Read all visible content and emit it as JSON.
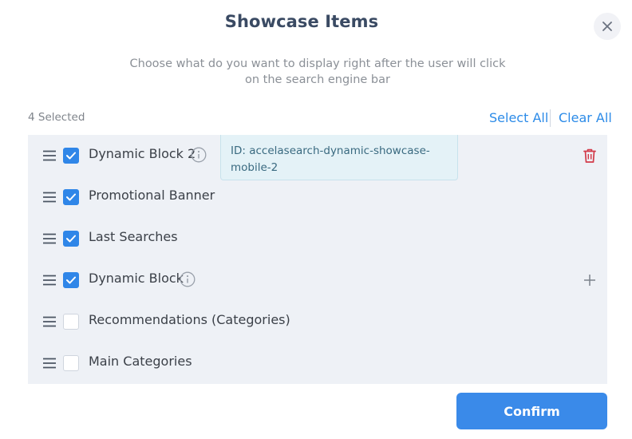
{
  "modal": {
    "title": "Showcase Items",
    "subtitle": "Choose what do you want to display right after the user will click on the search engine bar",
    "close_icon": "close-icon"
  },
  "toolbar": {
    "selected_count": "4 Selected",
    "select_all_label": "Select All",
    "clear_all_label": "Clear All"
  },
  "items": [
    {
      "label": "Dynamic Block 2",
      "checked": true,
      "has_info": true,
      "action": "delete"
    },
    {
      "label": "Promotional Banner",
      "checked": true,
      "has_info": false,
      "action": null
    },
    {
      "label": "Last Searches",
      "checked": true,
      "has_info": false,
      "action": null
    },
    {
      "label": "Dynamic Block",
      "checked": true,
      "has_info": true,
      "action": "add"
    },
    {
      "label": "Recommendations (Categories)",
      "checked": false,
      "has_info": false,
      "action": null
    },
    {
      "label": "Main Categories",
      "checked": false,
      "has_info": false,
      "action": null
    }
  ],
  "tooltip": {
    "text": "ID: accelasearch-dynamic-showcase-mobile-2"
  },
  "footer": {
    "confirm_label": "Confirm"
  },
  "colors": {
    "accent": "#2f86e8",
    "list_background": "#eef1f6",
    "delete": "#d23b4a",
    "tooltip_background": "#e4f2f7"
  }
}
